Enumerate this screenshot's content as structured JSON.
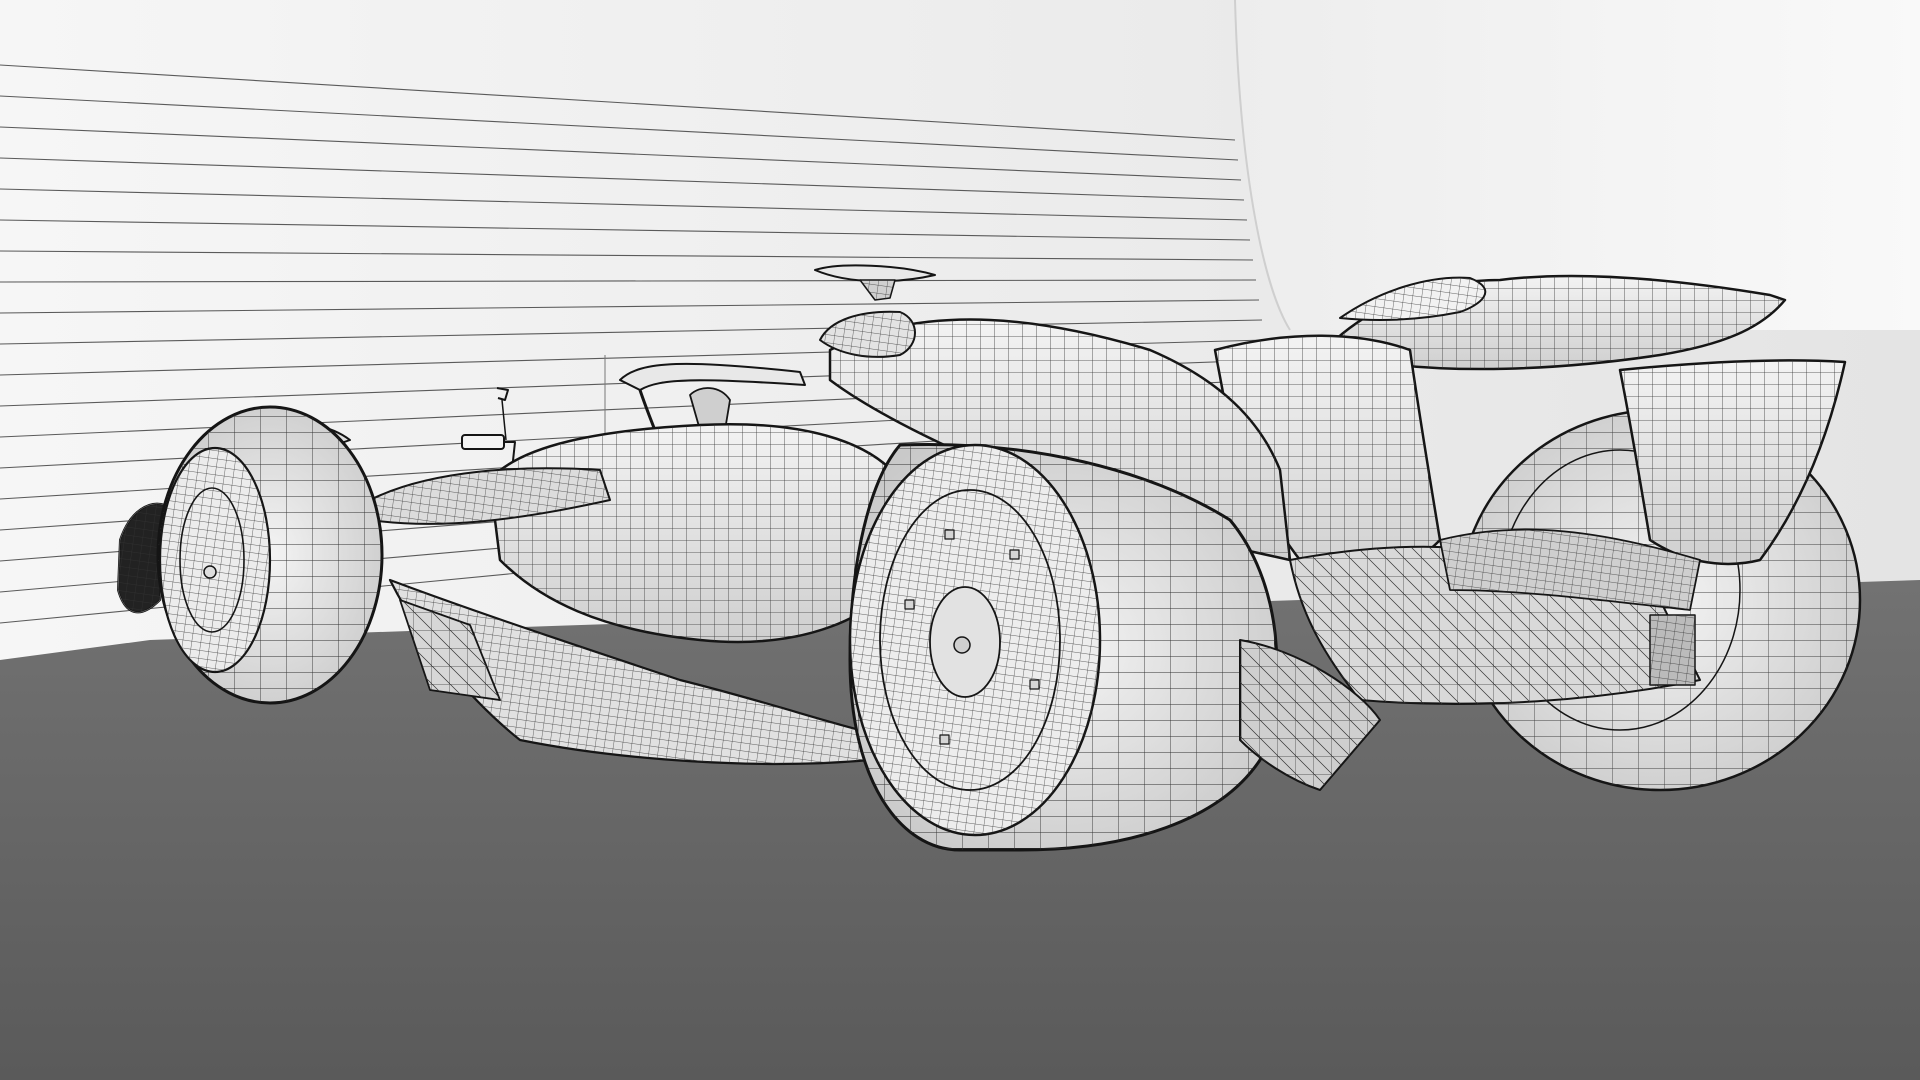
{
  "scene": {
    "colors": {
      "floor_far": "#707070",
      "floor_near": "#5c5c5c",
      "wall_left": "#f2f2f2",
      "wall_right": "#f8f8f8",
      "wall_lines": "#5a5a5a",
      "car_surface": "#ececec",
      "car_shadow": "#bdbdbd",
      "wire": "#2a2a2a",
      "outline": "#111111"
    },
    "icons": [
      "wireframe-race-car",
      "wind-tunnel-wall",
      "wind-tunnel-floor"
    ]
  }
}
